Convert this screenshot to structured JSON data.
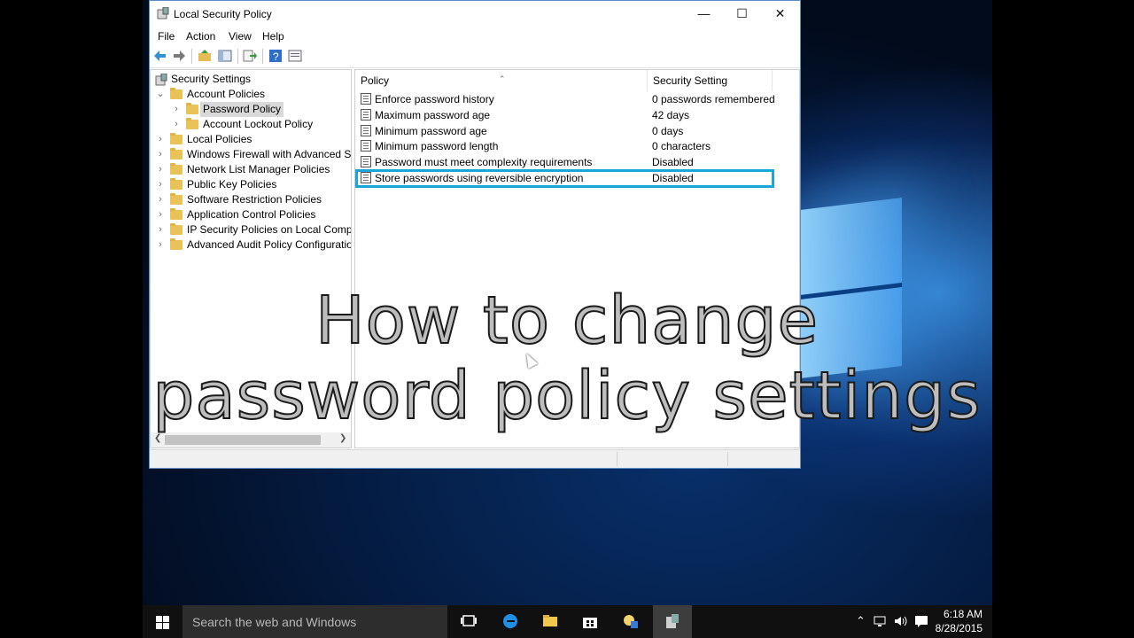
{
  "window": {
    "title": "Local Security Policy",
    "controls": {
      "minimize": "—",
      "maximize": "☐",
      "close": "✕"
    }
  },
  "menu": [
    "File",
    "Action",
    "View",
    "Help"
  ],
  "tree": {
    "root": "Security Settings",
    "items": [
      {
        "label": "Account Policies",
        "level": 1,
        "expanded": true
      },
      {
        "label": "Password Policy",
        "level": 2,
        "selected": true
      },
      {
        "label": "Account Lockout Policy",
        "level": 2
      },
      {
        "label": "Local Policies",
        "level": 1
      },
      {
        "label": "Windows Firewall with Advanced Secu",
        "level": 1
      },
      {
        "label": "Network List Manager Policies",
        "level": 1
      },
      {
        "label": "Public Key Policies",
        "level": 1
      },
      {
        "label": "Software Restriction Policies",
        "level": 1
      },
      {
        "label": "Application Control Policies",
        "level": 1
      },
      {
        "label": "IP Security Policies on Local Compute",
        "level": 1
      },
      {
        "label": "Advanced Audit Policy Configuration",
        "level": 1
      }
    ]
  },
  "list": {
    "columns": [
      "Policy",
      "Security Setting"
    ],
    "rows": [
      {
        "policy": "Enforce password history",
        "setting": "0 passwords remembered"
      },
      {
        "policy": "Maximum password age",
        "setting": "42 days"
      },
      {
        "policy": "Minimum password age",
        "setting": "0 days"
      },
      {
        "policy": "Minimum password length",
        "setting": "0 characters"
      },
      {
        "policy": "Password must meet complexity requirements",
        "setting": "Disabled"
      },
      {
        "policy": "Store passwords using reversible encryption",
        "setting": "Disabled",
        "highlighted": true
      }
    ]
  },
  "overlay": {
    "line1": "How to change",
    "line2": "password policy settings"
  },
  "taskbar": {
    "search_placeholder": "Search the web and Windows",
    "time": "6:18 AM",
    "date": "8/28/2015"
  },
  "colors": {
    "highlight": "#1aa6d6",
    "window_border": "#5b8fc7",
    "taskbar": "#101010"
  },
  "icons": [
    "back-icon",
    "forward-icon",
    "up-folder-icon",
    "show-hide-tree-icon",
    "export-icon",
    "help-icon",
    "properties-icon"
  ]
}
